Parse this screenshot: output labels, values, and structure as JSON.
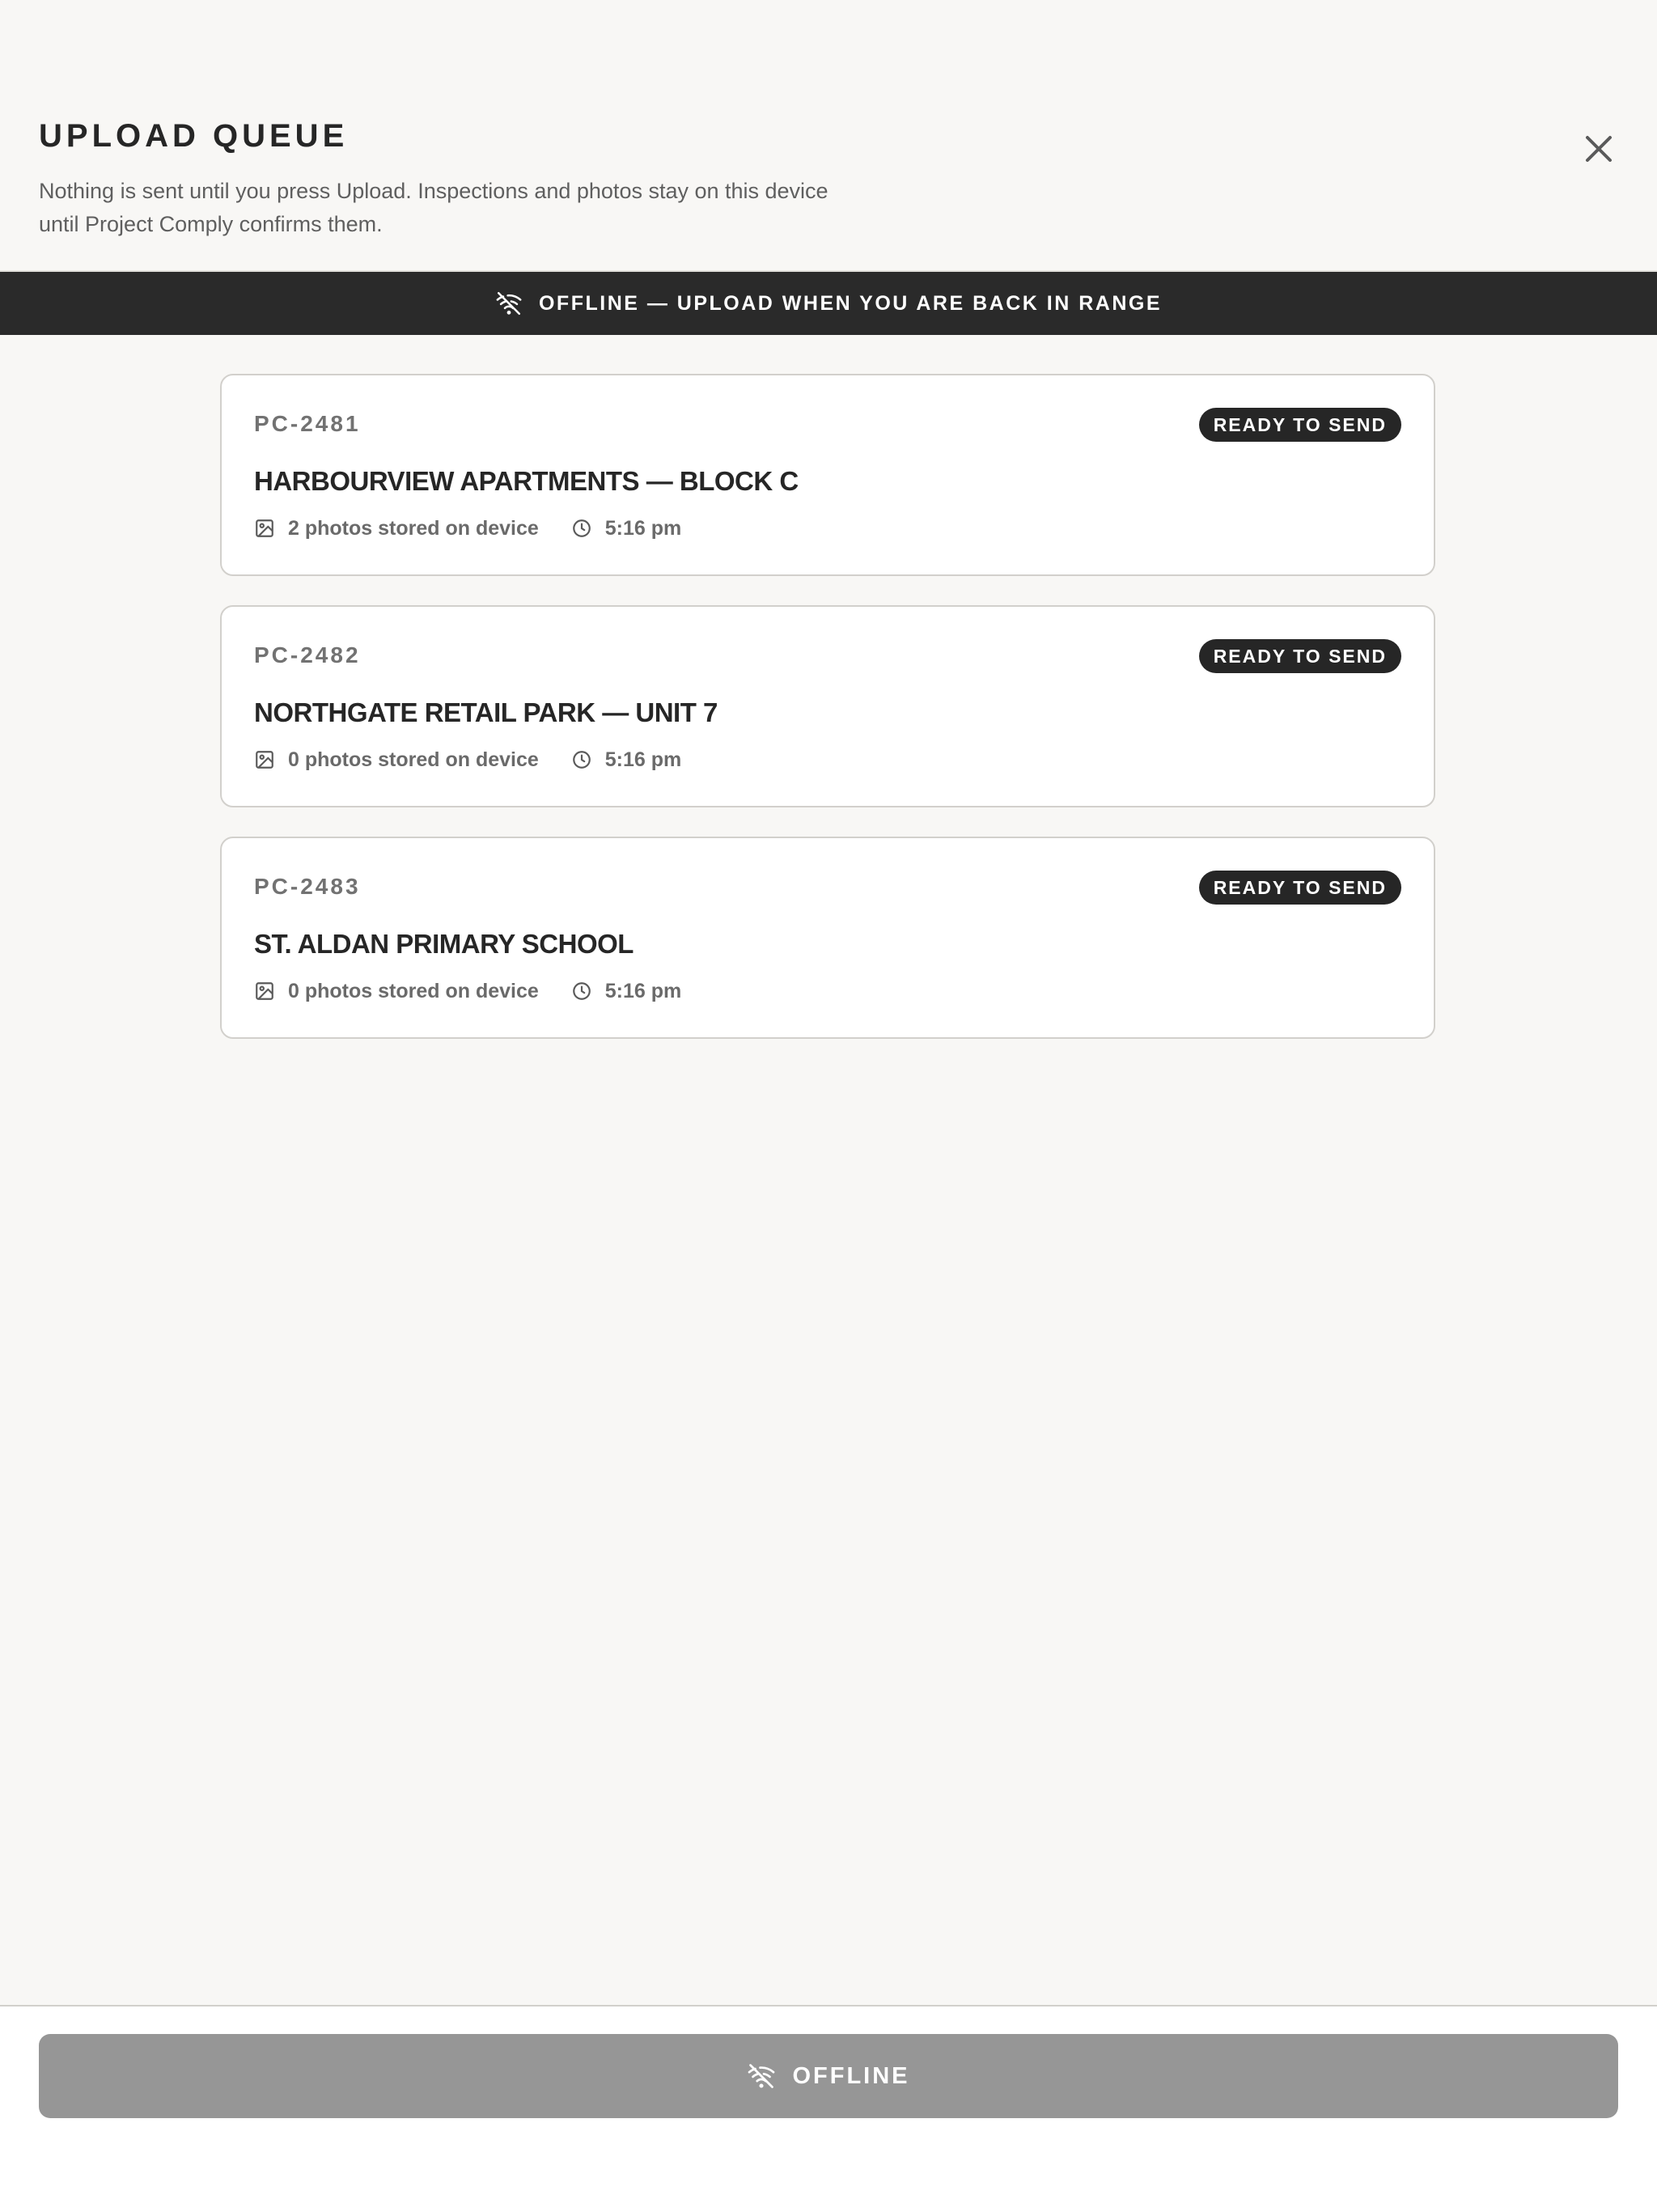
{
  "header": {
    "title": "UPLOAD QUEUE",
    "subtitle_line1": "Nothing is sent until you press Upload. Inspections and photos stay on this device",
    "subtitle_line2": "until Project Comply confirms them.",
    "close_icon": "close-icon"
  },
  "banner": {
    "icon": "wifi-off-icon",
    "text": "OFFLINE — UPLOAD WHEN YOU ARE BACK IN RANGE"
  },
  "queue": [
    {
      "id": "PC-2481",
      "status": "READY TO SEND",
      "name": "HARBOURVIEW APARTMENTS — BLOCK C",
      "photos": "2 photos stored on device",
      "time": "5:16 pm"
    },
    {
      "id": "PC-2482",
      "status": "READY TO SEND",
      "name": "NORTHGATE RETAIL PARK — UNIT 7",
      "photos": "0 photos stored on device",
      "time": "5:16 pm"
    },
    {
      "id": "PC-2483",
      "status": "READY TO SEND",
      "name": "ST. ALDAN PRIMARY SCHOOL",
      "photos": "0 photos stored on device",
      "time": "5:16 pm"
    }
  ],
  "footer": {
    "button_label": "OFFLINE",
    "button_icon": "wifi-off-icon"
  },
  "colors": {
    "background": "#f8f7f5",
    "banner": "#2a2a2a",
    "badge": "#262626",
    "disabled_button": "#969696"
  }
}
